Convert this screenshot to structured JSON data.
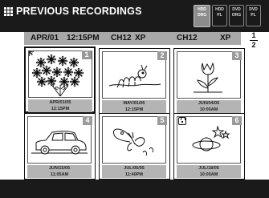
{
  "header": {
    "title": "PREVIOUS RECORDINGS",
    "modes": [
      {
        "line1": "HDD",
        "line2": "ORG",
        "active": true
      },
      {
        "line1": "HDD",
        "line2": "PL",
        "active": false
      },
      {
        "line1": "DVD",
        "line2": "ORG",
        "active": false
      },
      {
        "line1": "DVD",
        "line2": "PL",
        "active": false
      }
    ]
  },
  "info": {
    "date": "APR/01",
    "time": "12:15PM",
    "channel": "CH12",
    "mode": "XP",
    "current_channel": "CH12",
    "current_mode": "XP"
  },
  "page": {
    "current": "1",
    "total": "2"
  },
  "recordings": [
    {
      "number": "1",
      "date": "APR/01/05",
      "time": "12:15PM",
      "image": "flowers-icon",
      "protected": false,
      "selected": true
    },
    {
      "number": "2",
      "date": "MAY/01/05",
      "time": "12:15PM",
      "image": "caterpillar-icon",
      "protected": false,
      "selected": false
    },
    {
      "number": "3",
      "date": "JUN/04/05",
      "time": "10:00AM",
      "image": "tulip-icon",
      "protected": false,
      "selected": false
    },
    {
      "number": "4",
      "date": "JUN/15/05",
      "time": "11:05AM",
      "image": "car-icon",
      "protected": false,
      "selected": false
    },
    {
      "number": "5",
      "date": "JUL/05/05",
      "time": "11:40PM",
      "image": "butterfly-icon",
      "protected": false,
      "selected": false
    },
    {
      "number": "6",
      "date": "JUL/18/05",
      "time": "10:00AM",
      "image": "planet-stars-icon",
      "protected": true,
      "selected": false
    }
  ],
  "colors": {
    "bar": "#1a1a1a",
    "info_bar": "#a8a8a8",
    "caption": "#b4b4b4",
    "number_badge": "#9a9a9a"
  }
}
